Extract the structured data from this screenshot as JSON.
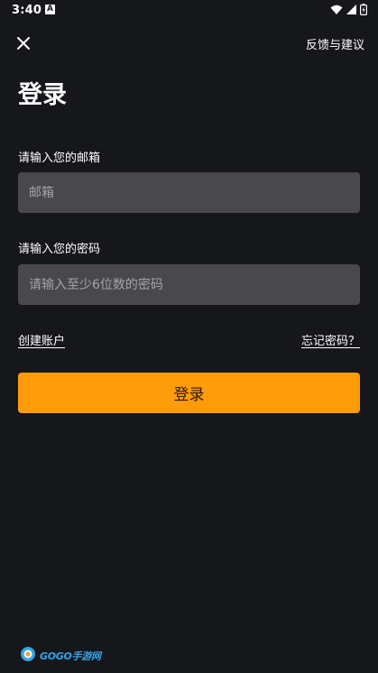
{
  "status_bar": {
    "time": "3:40",
    "notification_letter": "A"
  },
  "header": {
    "feedback_label": "反馈与建议"
  },
  "page": {
    "title": "登录"
  },
  "form": {
    "email_label": "请输入您的邮箱",
    "email_placeholder": "邮箱",
    "email_value": "",
    "password_label": "请输入您的密码",
    "password_placeholder": "请输入至少6位数的密码",
    "password_value": ""
  },
  "links": {
    "create_account": "创建账户",
    "forgot_password": "忘记密码？"
  },
  "actions": {
    "login_label": "登录"
  },
  "watermark": {
    "text": "GOGO手游网"
  },
  "colors": {
    "background": "#16171b",
    "input_background": "#48484d",
    "accent": "#ff9c0a"
  }
}
